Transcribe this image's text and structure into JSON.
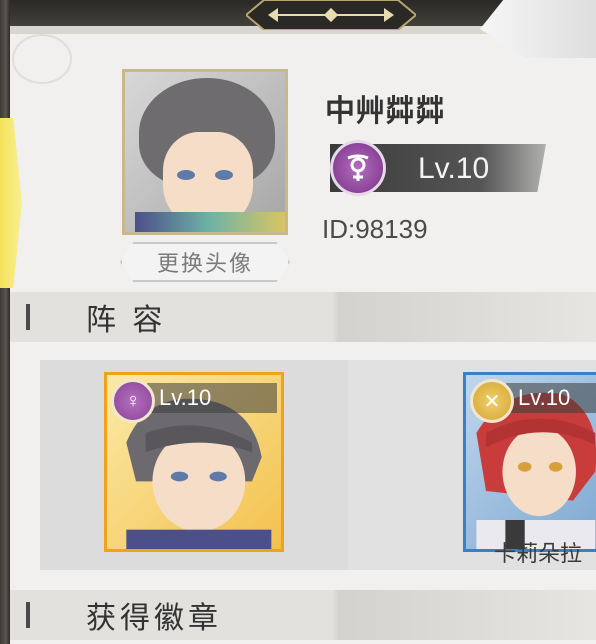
{
  "profile": {
    "player_name": "中艸茻茻",
    "level": "Lv.10",
    "player_id": "ID:98139",
    "change_avatar_label": "更换头像",
    "faction_emblem_icon": "purple-faction-emblem-icon"
  },
  "sections": {
    "lineup_title": "阵 容",
    "badges_title": "获得徽章"
  },
  "lineup": [
    {
      "level": "Lv.10",
      "name": "",
      "emblem_icon": "purple-faction-emblem-icon",
      "frame_color": "#f1a21a"
    },
    {
      "level": "Lv.10",
      "name": "卡莉朵拉",
      "emblem_icon": "crossed-swords-emblem-icon",
      "frame_color": "#3a7fc8"
    }
  ],
  "colors": {
    "accent_gold": "#c7b98c",
    "faction_purple": "#8a4396",
    "panel_bg": "#f1f0ee"
  }
}
